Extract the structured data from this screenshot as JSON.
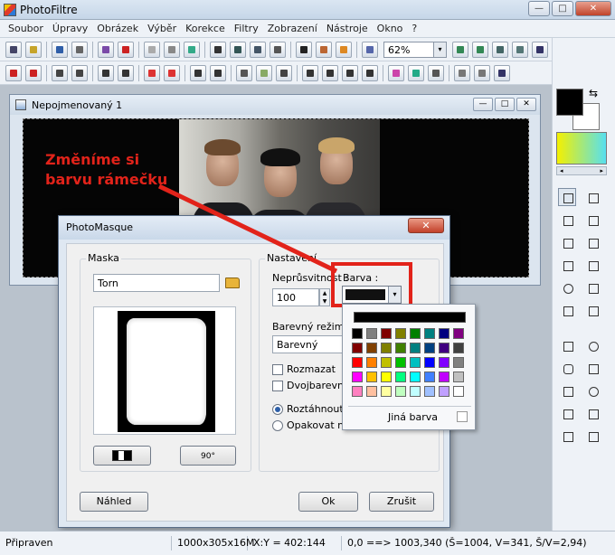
{
  "app": {
    "title": "PhotoFiltre",
    "window_controls": {
      "minimize": "—",
      "maximize": "□",
      "close": "✕"
    }
  },
  "menu": [
    "Soubor",
    "Úpravy",
    "Obrázek",
    "Výběr",
    "Korekce",
    "Filtry",
    "Zobrazení",
    "Nástroje",
    "Okno",
    "?"
  ],
  "toolbar": {
    "zoom_value": "62%",
    "zoom_arrow": "▾",
    "icons_row1": [
      "new-icon",
      "open-icon",
      "save-icon",
      "print-icon",
      "scan-icon",
      "undo-icon",
      "redo-icon",
      "grey-icon",
      "color-icon",
      "move-icon",
      "crop-icon",
      "resize-icon",
      "canvas-icon",
      "text-icon",
      "filter-icon",
      "settings-icon",
      "help-icon",
      "zoom-in-icon",
      "zoom-out-icon",
      "fit-icon",
      "actual-size-icon",
      "fullscreen-icon"
    ],
    "icons_row2": [
      "auto-levels-icon",
      "auto-contrast-icon",
      "brightness-plus-icon",
      "brightness-minus-icon",
      "contrast-plus-icon",
      "contrast-minus-icon",
      "saturation-plus-icon",
      "saturation-minus-icon",
      "gamma-plus-icon",
      "gamma-minus-icon",
      "grid-icon",
      "dither-icon",
      "hue-icon",
      "blur-icon",
      "sharpen-icon",
      "noise-icon",
      "relief-icon",
      "gradient-icon",
      "pattern-icon",
      "frame-icon",
      "mirror-icon",
      "flip-icon",
      "rotate-icon"
    ]
  },
  "document": {
    "name": "Nepojmenovaný 1",
    "controls": {
      "minimize": "—",
      "maximize": "□",
      "close": "✕"
    }
  },
  "annotation": "Změníme si\nbarvu rámečku",
  "dialog": {
    "title": "PhotoMasque",
    "close": "✕",
    "mask_group": "Maska",
    "mask_name": "Torn",
    "mask_button_icon": "swap-icon",
    "rotate_button_icon": "rotate-90-icon",
    "rotate_label": "90°",
    "settings_group": "Nastavení",
    "opacity_label": "Neprůsvitnost :",
    "opacity_value": "100",
    "color_label": "Barva :",
    "color_value": "#111111",
    "color_arrow": "▾",
    "color_mode_label": "Barevný režim :",
    "color_mode_value": "Barevný",
    "blur_label": "Rozmazat",
    "twocolor_label": "Dvojbarevně",
    "stretch_label": "Roztáhnout mas",
    "repeat_label": "Opakovat masku",
    "preview_button": "Náhled",
    "ok_button": "Ok",
    "cancel_button": "Zrušit",
    "spin_up": "▲",
    "spin_down": "▼"
  },
  "palette": {
    "top_color": "#000000",
    "rows": [
      [
        "#000000",
        "#808080",
        "#800000",
        "#808000",
        "#008000",
        "#008080",
        "#000080",
        "#800080"
      ],
      [
        "#800000",
        "#804000",
        "#808000",
        "#408000",
        "#008080",
        "#004080",
        "#400080",
        "#404040"
      ],
      [
        "#ff0000",
        "#ff8000",
        "#c0c000",
        "#00c000",
        "#00c0c0",
        "#0000ff",
        "#8000ff",
        "#808080"
      ],
      [
        "#ff00ff",
        "#ffc000",
        "#ffff00",
        "#00ff80",
        "#00ffff",
        "#4080ff",
        "#c000ff",
        "#c0c0c0"
      ],
      [
        "#ff80c0",
        "#ffc0a0",
        "#ffffa0",
        "#c0ffc0",
        "#c0ffff",
        "#a0c0ff",
        "#c0a0ff",
        "#ffffff"
      ]
    ],
    "more_label": "Jiná barva"
  },
  "right_panel": {
    "swap_icon": "⇆",
    "scroll_left": "◂",
    "scroll_right": "▸",
    "tools": [
      {
        "name": "select-icon",
        "radius": "0"
      },
      {
        "name": "pipette-icon",
        "radius": "0"
      },
      {
        "name": "magic-wand-icon",
        "radius": "0"
      },
      {
        "name": "line-icon",
        "radius": "0"
      },
      {
        "name": "fill-icon",
        "radius": "0"
      },
      {
        "name": "spray-icon",
        "radius": "0"
      },
      {
        "name": "brush-icon",
        "radius": "0"
      },
      {
        "name": "advanced-brush-icon",
        "radius": "0"
      },
      {
        "name": "blur-drop-icon",
        "radius": "50%"
      },
      {
        "name": "smudge-icon",
        "radius": "0"
      },
      {
        "name": "stamp-icon",
        "radius": "0"
      },
      {
        "name": "hand-icon",
        "radius": "0"
      },
      {
        "name": "rectangle-icon",
        "radius": "0"
      },
      {
        "name": "ellipse-icon",
        "radius": "50%"
      },
      {
        "name": "rounded-rect-icon",
        "radius": "30%"
      },
      {
        "name": "diamond-icon",
        "radius": "0"
      },
      {
        "name": "triangle-icon",
        "radius": "0"
      },
      {
        "name": "lasso-icon",
        "radius": "50%"
      },
      {
        "name": "polygon-icon",
        "radius": "0"
      },
      {
        "name": "folder-icon",
        "radius": "0"
      },
      {
        "name": "select-rect-icon",
        "radius": "0"
      },
      {
        "name": "select-text-icon",
        "radius": "0"
      }
    ]
  },
  "status": {
    "ready": "Připraven",
    "size": "1000x305x16M",
    "coords": "X:Y = 402:144",
    "selection": "0,0 ==> 1003,340 (Š=1004, V=341, Š/V=2,94)"
  }
}
